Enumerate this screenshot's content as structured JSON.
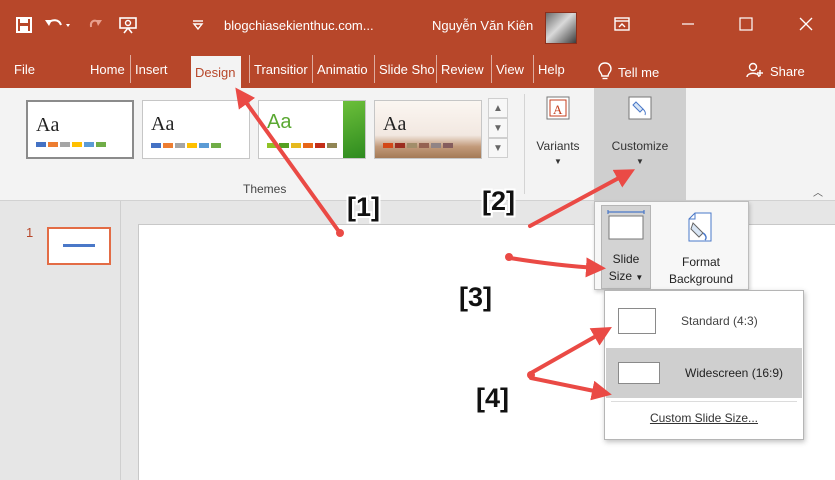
{
  "titlebar": {
    "doc_title": "blogchiasekienthuc.com...",
    "user_name": "Nguyễn Văn Kiên",
    "accent": "#b7472a"
  },
  "tabs": [
    {
      "label": "File"
    },
    {
      "label": "Home"
    },
    {
      "label": "Insert"
    },
    {
      "label": "Design"
    },
    {
      "label": "Transitior"
    },
    {
      "label": "Animatio"
    },
    {
      "label": "Slide Sho"
    },
    {
      "label": "Review"
    },
    {
      "label": "View"
    },
    {
      "label": "Help"
    }
  ],
  "tell_me": "Tell me",
  "share": "Share",
  "ribbon": {
    "theme_sample": "Aa",
    "themes_label": "Themes",
    "variants_label": "Variants",
    "customize_label": "Customize"
  },
  "thumbnails": {
    "slide_number": "1"
  },
  "customize_panel": {
    "slide_size_line1": "Slide",
    "slide_size_line2": "Size",
    "format_bg_line1": "Format",
    "format_bg_line2": "Background"
  },
  "slide_size_menu": {
    "standard": "Standard (4:3)",
    "widescreen": "Widescreen (16:9)",
    "custom": "Custom Slide Size..."
  },
  "annotations": {
    "m1": "[1]",
    "m2": "[2]",
    "m3": "[3]",
    "m4": "[4]",
    "arrow_color": "#ea4a45"
  },
  "icons": [
    "save-icon",
    "undo-icon",
    "redo-icon",
    "present-icon",
    "customize-qat-icon",
    "ribbon-display-icon",
    "minimize-icon",
    "maximize-icon",
    "close-icon",
    "lightbulb-icon",
    "share-icon",
    "variants-icon",
    "customize-icon",
    "slide-size-icon",
    "format-background-icon"
  ]
}
